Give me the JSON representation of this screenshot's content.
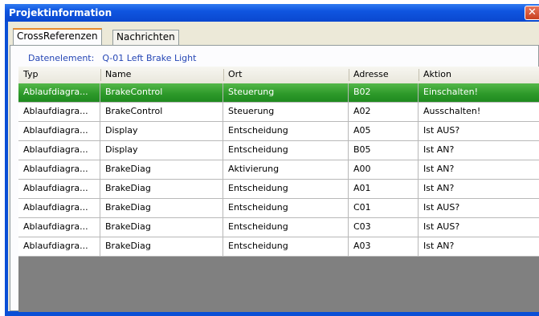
{
  "window": {
    "title": "Projektinformation",
    "close_glyph": "✕"
  },
  "tabs": [
    {
      "label": "CrossReferenzen",
      "active": true
    },
    {
      "label": "Nachrichten",
      "active": false
    }
  ],
  "data_element": {
    "label": "Datenelement:",
    "value": "Q-01  Left Brake Light"
  },
  "table": {
    "columns": [
      "Typ",
      "Name",
      "Ort",
      "Adresse",
      "Aktion"
    ],
    "rows": [
      {
        "typ": "Ablaufdiagra...",
        "name": "BrakeControl",
        "ort": "Steuerung",
        "adresse": "B02",
        "aktion": "Einschalten!",
        "selected": true
      },
      {
        "typ": "Ablaufdiagra...",
        "name": "BrakeControl",
        "ort": "Steuerung",
        "adresse": "A02",
        "aktion": "Ausschalten!"
      },
      {
        "typ": "Ablaufdiagra...",
        "name": "Display",
        "ort": "Entscheidung",
        "adresse": "A05",
        "aktion": "Ist AUS?"
      },
      {
        "typ": "Ablaufdiagra...",
        "name": "Display",
        "ort": "Entscheidung",
        "adresse": "B05",
        "aktion": "Ist AN?"
      },
      {
        "typ": "Ablaufdiagra...",
        "name": "BrakeDiag",
        "ort": "Aktivierung",
        "adresse": "A00",
        "aktion": "Ist AN?"
      },
      {
        "typ": "Ablaufdiagra...",
        "name": "BrakeDiag",
        "ort": "Entscheidung",
        "adresse": "A01",
        "aktion": "Ist AN?"
      },
      {
        "typ": "Ablaufdiagra...",
        "name": "BrakeDiag",
        "ort": "Entscheidung",
        "adresse": "C01",
        "aktion": "Ist AUS?"
      },
      {
        "typ": "Ablaufdiagra...",
        "name": "BrakeDiag",
        "ort": "Entscheidung",
        "adresse": "C03",
        "aktion": "Ist AUS?"
      },
      {
        "typ": "Ablaufdiagra...",
        "name": "BrakeDiag",
        "ort": "Entscheidung",
        "adresse": "A03",
        "aktion": "Ist AN?"
      }
    ]
  },
  "colors": {
    "titlebar": "#0a4fd6",
    "selection": "#2e9a2a",
    "accent_text": "#2546b5"
  }
}
